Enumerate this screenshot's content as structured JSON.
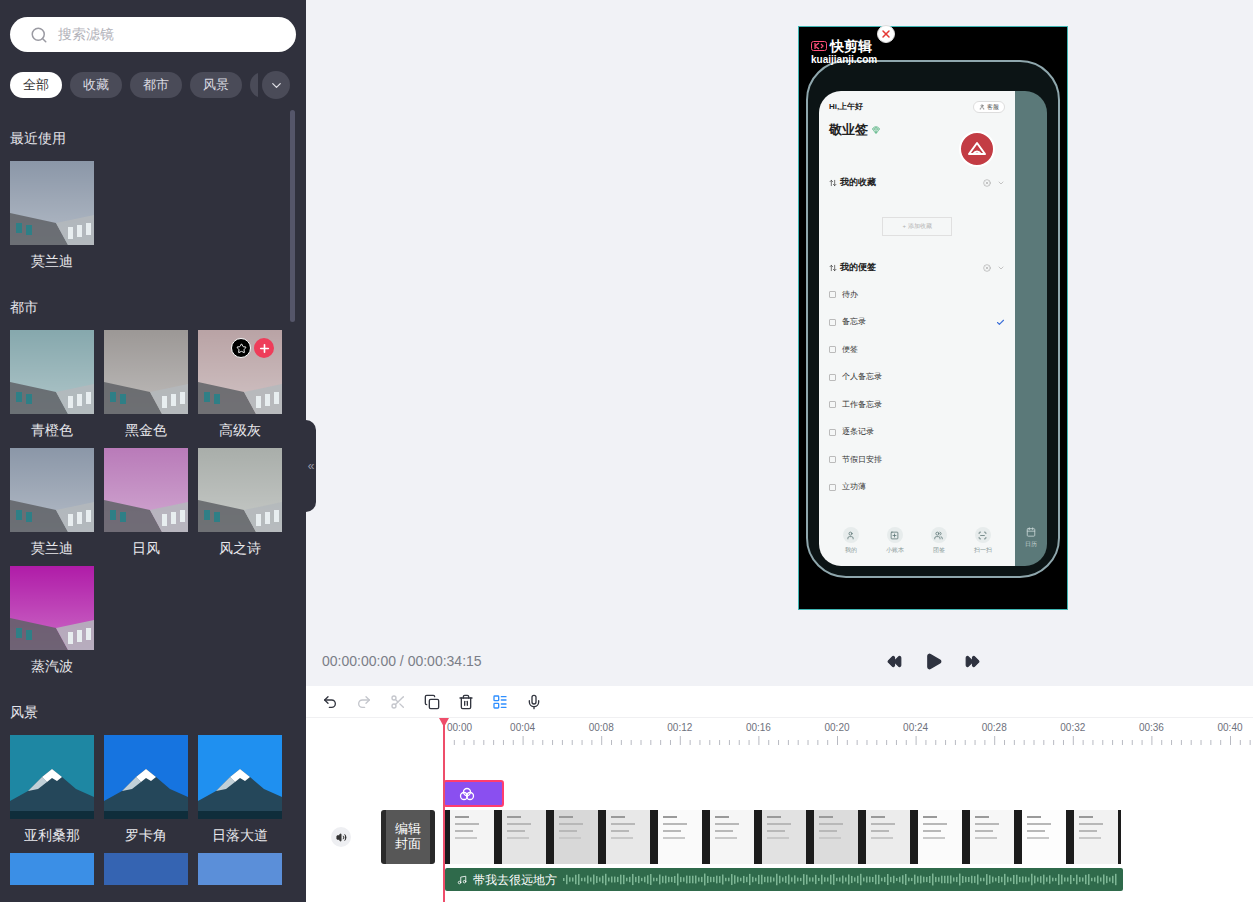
{
  "search": {
    "placeholder": "搜索滤镜"
  },
  "tabs": [
    {
      "label": "全部",
      "selected": true
    },
    {
      "label": "收藏",
      "selected": false
    },
    {
      "label": "都市",
      "selected": false
    },
    {
      "label": "风景",
      "selected": false
    },
    {
      "label": "",
      "selected": false
    }
  ],
  "collapse_handle": "«",
  "sections": [
    {
      "title": "最近使用",
      "filters": [
        {
          "name": "莫兰迪",
          "kind": "city",
          "color": "#8b97a8",
          "hovered": false
        }
      ]
    },
    {
      "title": "都市",
      "filters": [
        {
          "name": "青橙色",
          "kind": "city",
          "color": "#86a8ad",
          "hovered": false
        },
        {
          "name": "黑金色",
          "kind": "city",
          "color": "#9c9896",
          "hovered": false
        },
        {
          "name": "高级灰",
          "kind": "city",
          "color": "#b9a3a5",
          "hovered": true
        },
        {
          "name": "莫兰迪",
          "kind": "city",
          "color": "#8b97a8",
          "hovered": false
        },
        {
          "name": "日风",
          "kind": "city",
          "color": "#b97bb9",
          "hovered": false
        },
        {
          "name": "风之诗",
          "kind": "city",
          "color": "#a9aeaa",
          "hovered": false
        },
        {
          "name": "蒸汽波",
          "kind": "city",
          "color": "#b01ca8",
          "hovered": false
        }
      ]
    },
    {
      "title": "风景",
      "filters": [
        {
          "name": "亚利桑那",
          "kind": "landscape",
          "color": "#1e87a3",
          "hovered": false
        },
        {
          "name": "罗卡角",
          "kind": "landscape",
          "color": "#1674e0",
          "hovered": false
        },
        {
          "name": "日落大道",
          "kind": "landscape",
          "color": "#1f90f0",
          "hovered": false
        },
        {
          "name": "",
          "kind": "landscape",
          "color": "#3b8fe6",
          "hovered": false
        },
        {
          "name": "",
          "kind": "landscape",
          "color": "#3564b2",
          "hovered": false
        },
        {
          "name": "",
          "kind": "landscape",
          "color": "#5b8fd9",
          "hovered": false
        }
      ]
    }
  ],
  "preview": {
    "watermark": {
      "brand": "快剪辑",
      "site": "kuaijianji.com"
    },
    "app": {
      "greeting": "Hi,上午好",
      "title": "敬业签",
      "service": "客服",
      "favorites": {
        "title": "我的收藏",
        "add": "+ 添加收藏"
      },
      "notes": {
        "title": "我的便签",
        "items": [
          {
            "label": "待办",
            "checked": false
          },
          {
            "label": "备忘录",
            "checked": true
          },
          {
            "label": "便签",
            "checked": false
          },
          {
            "label": "个人备忘录",
            "checked": false
          },
          {
            "label": "工作备忘录",
            "checked": false
          },
          {
            "label": "逐条记录",
            "checked": false
          },
          {
            "label": "节假日安排",
            "checked": false
          },
          {
            "label": "立功薄",
            "checked": false
          }
        ]
      },
      "nav": [
        {
          "label": "我的",
          "kind": "user"
        },
        {
          "label": "小账本",
          "kind": "book"
        },
        {
          "label": "团签",
          "kind": "team"
        },
        {
          "label": "扫一扫",
          "kind": "scan"
        }
      ],
      "side_nav": {
        "label": "日历"
      }
    }
  },
  "time_display": {
    "current": "00:00:00:00",
    "separator": "/",
    "total": "00:00:34:15"
  },
  "toolbar": [
    {
      "kind": "undo",
      "disabled": false,
      "active": false
    },
    {
      "kind": "redo",
      "disabled": true,
      "active": false
    },
    {
      "kind": "cut",
      "disabled": true,
      "active": false
    },
    {
      "kind": "copy",
      "disabled": false,
      "active": false
    },
    {
      "kind": "delete",
      "disabled": false,
      "active": false
    },
    {
      "kind": "layout",
      "disabled": false,
      "active": true
    },
    {
      "kind": "mic",
      "disabled": false,
      "active": false
    }
  ],
  "timeline": {
    "ticks": [
      "00:00",
      "00:04",
      "00:08",
      "00:12",
      "00:16",
      "00:20",
      "00:24",
      "00:28",
      "00:32",
      "00:36",
      "00:40"
    ],
    "filter_clip": {
      "selected": true
    },
    "cover_label": "编辑封面",
    "audio": {
      "title": "带我去很远地方"
    }
  }
}
